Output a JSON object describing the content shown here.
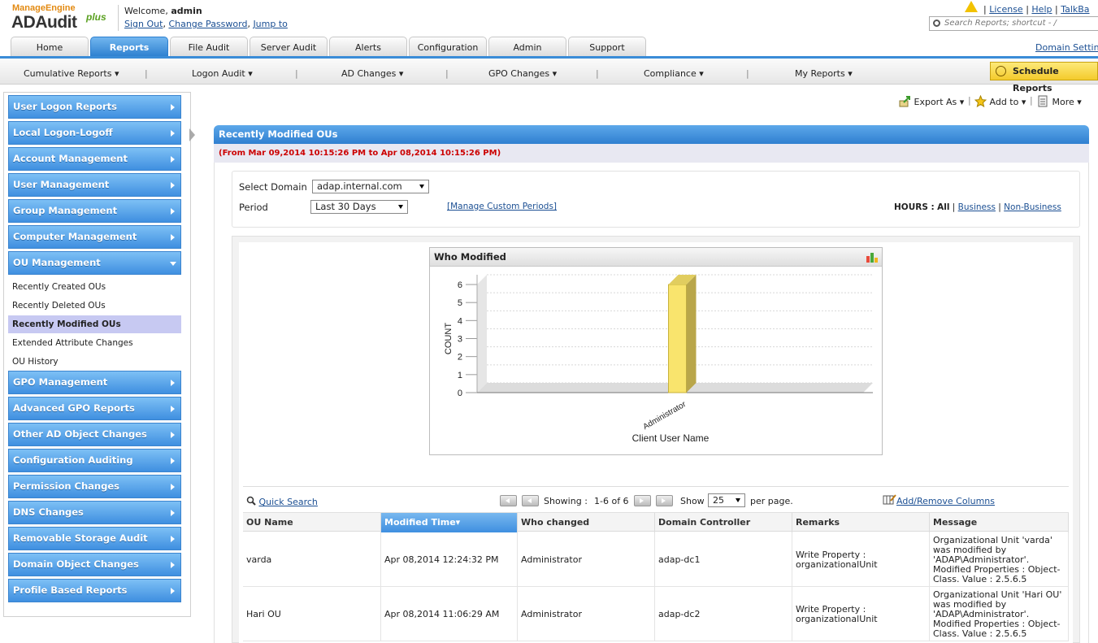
{
  "app": {
    "brand_top_a": "Manage",
    "brand_top_b": "Engine",
    "product": "ADAudit",
    "plus": "plus"
  },
  "header": {
    "welcome_prefix": "Welcome,",
    "user": "admin",
    "links": [
      "Sign Out",
      "Change Password",
      "Jump to"
    ],
    "top_links": [
      "License",
      "Help",
      "TalkBa"
    ],
    "search_placeholder": "Search Reports; shortcut - /",
    "domain_settings": "Domain Settin"
  },
  "tabs": [
    {
      "label": "Home",
      "active": false
    },
    {
      "label": "Reports",
      "active": true
    },
    {
      "label": "File Audit",
      "active": false
    },
    {
      "label": "Server Audit",
      "active": false
    },
    {
      "label": "Alerts",
      "active": false
    },
    {
      "label": "Configuration",
      "active": false
    },
    {
      "label": "Admin",
      "active": false
    },
    {
      "label": "Support",
      "active": false
    }
  ],
  "subnav": [
    "Cumulative Reports ▾",
    "Logon Audit ▾",
    "AD Changes ▾",
    "GPO Changes ▾",
    "Compliance ▾",
    "My Reports ▾"
  ],
  "schedule_button": "Schedule Reports",
  "sidebar": {
    "groups_before": [
      "User Logon Reports",
      "Local Logon-Logoff",
      "Account Management",
      "User Management",
      "Group Management",
      "Computer Management"
    ],
    "expanded": "OU Management",
    "sub_items": [
      "Recently Created OUs",
      "Recently Deleted OUs",
      "Recently Modified OUs",
      "Extended Attribute Changes",
      "OU History"
    ],
    "selected_sub": "Recently Modified OUs",
    "groups_after": [
      "GPO Management",
      "Advanced GPO Reports",
      "Other AD Object Changes",
      "Configuration Auditing",
      "Permission Changes",
      "DNS Changes",
      "Removable Storage Audit",
      "Domain Object Changes",
      "Profile Based Reports"
    ]
  },
  "actions": {
    "export": "Export As ▾",
    "add_to": "Add to ▾",
    "more": "More ▾"
  },
  "report": {
    "title": "Recently Modified OUs",
    "range": "(From Mar 09,2014 10:15:26 PM to Apr 08,2014 10:15:26 PM)",
    "select_domain_label": "Select Domain",
    "domain_value": "adap.internal.com",
    "period_label": "Period",
    "period_value": "Last 30 Days",
    "manage_custom": "[Manage Custom Periods]",
    "hours_label": "HOURS :",
    "hours_all": "All",
    "hours_business": "Business",
    "hours_nonbusiness": "Non-Business"
  },
  "chart_data": {
    "type": "bar",
    "title": "Who Modified",
    "categories": [
      "Administrator"
    ],
    "values": [
      6
    ],
    "xlabel": "Client User Name",
    "ylabel": "COUNT",
    "ylim": [
      0,
      6
    ],
    "yticks": [
      "0",
      "1",
      "2",
      "3",
      "4",
      "5",
      "6"
    ],
    "bar_color": "#f9e46d",
    "grid": true
  },
  "grid": {
    "quick_search": "Quick Search",
    "showing_label": "Showing :",
    "showing_range": "1-6 of 6",
    "show_label": "Show",
    "page_size": "25",
    "per_page": "per page.",
    "add_remove": "Add/Remove Columns",
    "columns": [
      "OU Name",
      "Modified Time▾",
      "Who changed",
      "Domain Controller",
      "Remarks",
      "Message"
    ],
    "rows": [
      {
        "ou": "varda",
        "time": "Apr 08,2014 12:24:32 PM",
        "who": "Administrator",
        "dc": "adap-dc1",
        "remarks": "Write Property : organizationalUnit",
        "message": "Organizational Unit 'varda' was modified by 'ADAP\\Administrator'. Modified Properties : Object-Class. Value : 2.5.6.5"
      },
      {
        "ou": "Hari OU",
        "time": "Apr 08,2014 11:06:29 AM",
        "who": "Administrator",
        "dc": "adap-dc2",
        "remarks": "Write Property : organizationalUnit",
        "message": "Organizational Unit 'Hari OU' was modified by 'ADAP\\Administrator'. Modified Properties : Object-Class. Value : 2.5.6.5"
      }
    ]
  }
}
